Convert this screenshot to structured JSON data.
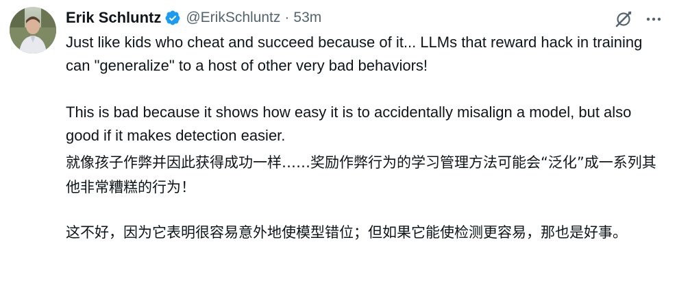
{
  "tweet": {
    "author": {
      "name": "Erik Schluntz",
      "handle": "@ErikSchluntz",
      "separator": "·",
      "time": "53m"
    },
    "text": {
      "p1": "Just like kids who cheat and succeed because of it... LLMs that reward hack in training can \"generalize\" to a host of other very bad behaviors!",
      "p2": "This is bad because it shows how easy it is to accidentally misalign a model, but also good if it makes detection easier."
    },
    "translation": {
      "p1": "就像孩子作弊并因此获得成功一样……奖励作弊行为的学习管理方法可能会“泛化”成一系列其他非常糟糕的行为！",
      "p2": "这不好，因为它表明很容易意外地使模型错位；但如果它能使检测更容易，那也是好事。"
    },
    "icons": {
      "verified": "verified-badge-icon",
      "grok": "grok-icon",
      "more": "more-icon"
    },
    "colors": {
      "verified": "#1d9bf0",
      "secondary_text": "#536471",
      "primary_text": "#0f1419"
    }
  }
}
